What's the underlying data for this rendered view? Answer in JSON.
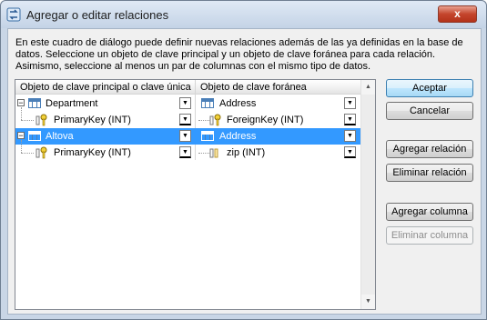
{
  "window": {
    "title": "Agregar o editar relaciones",
    "close_label": "x"
  },
  "description": "En este cuadro de diálogo puede definir nuevas relaciones además de las ya definidas en la base de datos. Seleccione un objeto de clave principal y un objeto de clave foránea para cada relación. Asimismo, seleccione al menos un par de columnas con el mismo tipo de datos.",
  "grid": {
    "headers": [
      "Objeto de clave principal o clave única",
      "Objeto de clave foránea"
    ],
    "rows": [
      {
        "left": "Department",
        "right": "Address",
        "kind": "table",
        "selected": false
      },
      {
        "left": "PrimaryKey (INT)",
        "right": "ForeignKey (INT)",
        "kind": "key",
        "selected": false
      },
      {
        "left": "Altova",
        "right": "Address",
        "kind": "table",
        "selected": true
      },
      {
        "left": "PrimaryKey (INT)",
        "right": "zip (INT)",
        "kind": "key",
        "selected": false
      }
    ]
  },
  "buttons": {
    "accept": "Aceptar",
    "cancel": "Cancelar",
    "add_relation": "Agregar relación",
    "remove_relation": "Eliminar relación",
    "add_column": "Agregar columna",
    "remove_column": "Eliminar columna"
  }
}
